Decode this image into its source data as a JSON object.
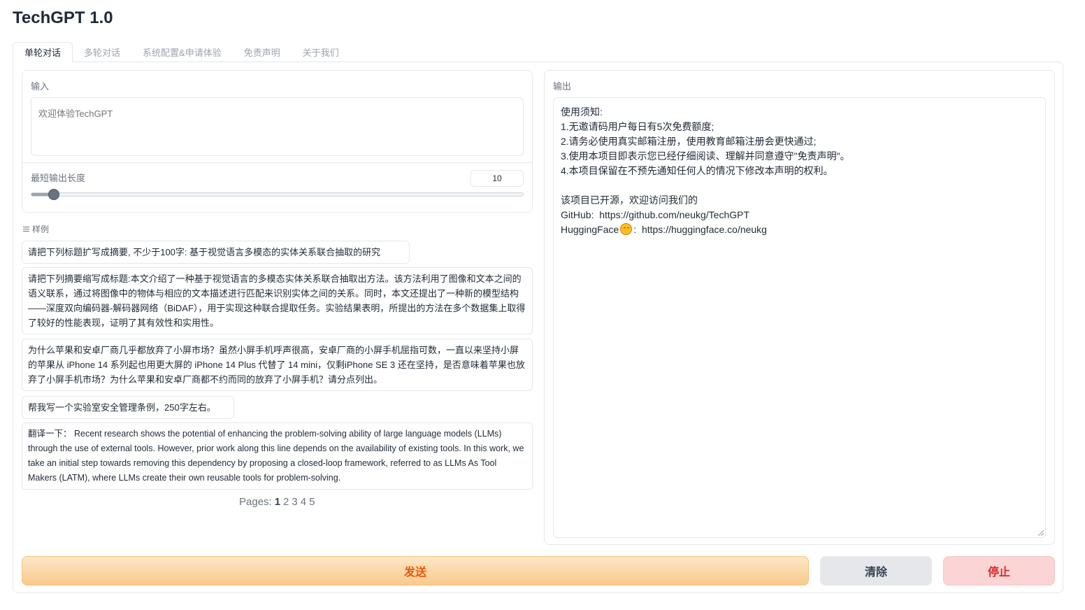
{
  "app": {
    "title": "TechGPT 1.0"
  },
  "tabs": [
    {
      "label": "单轮对话",
      "active": true
    },
    {
      "label": "多轮对话",
      "active": false
    },
    {
      "label": "系统配置&申请体验",
      "active": false
    },
    {
      "label": "免责声明",
      "active": false
    },
    {
      "label": "关于我们",
      "active": false
    }
  ],
  "input": {
    "label": "输入",
    "placeholder": "欢迎体验TechGPT",
    "value": ""
  },
  "min_length": {
    "label": "最短输出长度",
    "value": "10",
    "slider_fraction": 0.045
  },
  "examples": {
    "label": "样例",
    "items": [
      "请把下列标题扩写成摘要, 不少于100字: 基于视觉语言多模态的实体关系联合抽取的研究",
      "请把下列摘要缩写成标题:本文介绍了一种基于视觉语言的多模态实体关系联合抽取出方法。该方法利用了图像和文本之间的语义联系，通过将图像中的物体与相应的文本描述进行匹配来识别实体之间的关系。同时，本文还提出了一种新的模型结构——深度双向编码器-解码器网络（BiDAF），用于实现这种联合提取任务。实验结果表明，所提出的方法在多个数据集上取得了较好的性能表现，证明了其有效性和实用性。",
      "为什么苹果和安卓厂商几乎都放弃了小屏市场？虽然小屏手机呼声很高，安卓厂商的小屏手机屈指可数，一直以来坚持小屏的苹果从 iPhone 14 系列起也用更大屏的 iPhone 14 Plus 代替了 14 mini，仅剩iPhone SE 3 还在坚持，是否意味着苹果也放弃了小屏手机市场？为什么苹果和安卓厂商都不约而同的放弃了小屏手机？请分点列出。",
      "帮我写一个实验室安全管理条例，250字左右。",
      "翻译一下： Recent research shows the potential of enhancing the problem-solving ability of large language models (LLMs) through the use of external tools. However, prior work along this line depends on the availability of existing tools. In this work, we take an initial step towards removing this dependency by proposing a closed-loop framework, referred to as LLMs As Tool Makers (LATM), where LLMs create their own reusable tools for problem-solving."
    ]
  },
  "pagination": {
    "label": "Pages:",
    "pages": [
      "1",
      "2",
      "3",
      "4",
      "5"
    ],
    "current": "1"
  },
  "output": {
    "label": "输出",
    "lines": [
      "使用须知:",
      "1.无邀请码用户每日有5次免费额度;",
      "2.请务必使用真实邮箱注册，使用教育邮箱注册会更快通过;",
      "3.使用本项目即表示您已经仔细阅读、理解并同意遵守\"免责声明\"。",
      "4.本项目保留在不预先通知任何人的情况下修改本声明的权利。",
      "",
      "该项目已开源，欢迎访问我们的"
    ],
    "github_label": "GitHub:",
    "github_url": "https://github.com/neukg/TechGPT",
    "hf_label": "HuggingFace",
    "hf_sep": ":",
    "hf_url": "https://huggingface.co/neukg"
  },
  "buttons": {
    "send": "发送",
    "clear": "清除",
    "stop": "停止"
  }
}
